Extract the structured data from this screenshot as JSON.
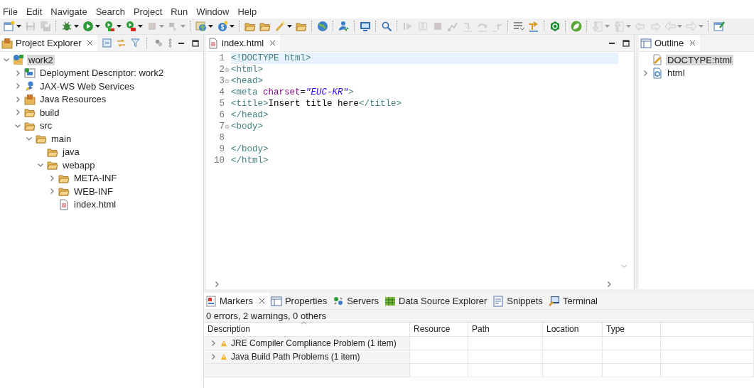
{
  "menu": [
    "File",
    "Edit",
    "Navigate",
    "Search",
    "Project",
    "Run",
    "Window",
    "Help"
  ],
  "toolbar": [
    {
      "kind": "new-window",
      "dropdown": true,
      "disabled": false
    },
    {
      "kind": "save",
      "dropdown": false,
      "disabled": true
    },
    {
      "kind": "save-all",
      "dropdown": false,
      "disabled": true
    },
    {
      "kind": "separator"
    },
    {
      "kind": "bug",
      "dropdown": true,
      "disabled": false
    },
    {
      "kind": "run",
      "dropdown": true,
      "disabled": false
    },
    {
      "kind": "run-coverage",
      "dropdown": true,
      "disabled": false
    },
    {
      "kind": "run-tool",
      "dropdown": true,
      "disabled": false
    },
    {
      "kind": "stop",
      "dropdown": true,
      "disabled": true
    },
    {
      "kind": "step",
      "dropdown": true,
      "disabled": true
    },
    {
      "kind": "separator"
    },
    {
      "kind": "globe-folder",
      "dropdown": true,
      "disabled": false
    },
    {
      "kind": "class",
      "dropdown": true,
      "disabled": false
    },
    {
      "kind": "separator"
    },
    {
      "kind": "folder",
      "dropdown": false,
      "disabled": false
    },
    {
      "kind": "folder",
      "dropdown": false,
      "disabled": false
    },
    {
      "kind": "wand",
      "dropdown": true,
      "disabled": false
    },
    {
      "kind": "folder",
      "dropdown": false,
      "disabled": false
    },
    {
      "kind": "separator"
    },
    {
      "kind": "globe",
      "dropdown": false,
      "disabled": false
    },
    {
      "kind": "separator"
    },
    {
      "kind": "person",
      "dropdown": false,
      "disabled": false
    },
    {
      "kind": "separator"
    },
    {
      "kind": "monitor",
      "dropdown": false,
      "disabled": false
    },
    {
      "kind": "separator"
    },
    {
      "kind": "search",
      "dropdown": false,
      "disabled": false
    },
    {
      "kind": "separator"
    },
    {
      "kind": "resume",
      "dropdown": false,
      "disabled": true
    },
    {
      "kind": "suspend",
      "dropdown": false,
      "disabled": true
    },
    {
      "kind": "stop",
      "dropdown": false,
      "disabled": true
    },
    {
      "kind": "disconnect",
      "dropdown": false,
      "disabled": true
    },
    {
      "kind": "step-into",
      "dropdown": false,
      "disabled": true
    },
    {
      "kind": "step-over",
      "dropdown": false,
      "disabled": true
    },
    {
      "kind": "step-return",
      "dropdown": false,
      "disabled": true
    },
    {
      "kind": "separator"
    },
    {
      "kind": "lines",
      "dropdown": false,
      "disabled": false
    },
    {
      "kind": "drop-frame",
      "dropdown": false,
      "disabled": false
    },
    {
      "kind": "separator"
    },
    {
      "kind": "hexagon",
      "dropdown": false,
      "disabled": false
    },
    {
      "kind": "separator"
    },
    {
      "kind": "leaf",
      "dropdown": false,
      "disabled": false
    },
    {
      "kind": "separator"
    },
    {
      "kind": "down-doc",
      "dropdown": true,
      "disabled": true
    },
    {
      "kind": "up-doc",
      "dropdown": true,
      "disabled": true
    },
    {
      "kind": "back-edit",
      "dropdown": false,
      "disabled": true
    },
    {
      "kind": "fwd-edit",
      "dropdown": false,
      "disabled": true
    },
    {
      "kind": "left",
      "dropdown": true,
      "disabled": true
    },
    {
      "kind": "right",
      "dropdown": true,
      "disabled": true
    },
    {
      "kind": "separator"
    },
    {
      "kind": "edit-window",
      "dropdown": false,
      "disabled": false
    }
  ],
  "explorer": {
    "title": "Project Explorer",
    "tree": [
      {
        "label": "work2",
        "kind": "project",
        "selected": true,
        "expanded": true,
        "children": [
          {
            "label": "Deployment Descriptor: work2",
            "kind": "descriptor",
            "selected": false,
            "expanded": false
          },
          {
            "label": "JAX-WS Web Services",
            "kind": "webservice",
            "selected": false,
            "expanded": false
          },
          {
            "label": "Java Resources",
            "kind": "resources",
            "selected": false,
            "expanded": false
          },
          {
            "label": "build",
            "kind": "folder",
            "selected": false,
            "expanded": false
          },
          {
            "label": "src",
            "kind": "folder",
            "selected": false,
            "expanded": true,
            "children": [
              {
                "label": "main",
                "kind": "folder",
                "selected": false,
                "expanded": true,
                "children": [
                  {
                    "label": "java",
                    "kind": "folder",
                    "selected": false
                  },
                  {
                    "label": "webapp",
                    "kind": "folder",
                    "selected": false,
                    "expanded": true,
                    "children": [
                      {
                        "label": "META-INF",
                        "kind": "folder",
                        "selected": false,
                        "expanded": false
                      },
                      {
                        "label": "WEB-INF",
                        "kind": "folder",
                        "selected": false,
                        "expanded": false
                      },
                      {
                        "label": "index.html",
                        "kind": "file",
                        "selected": false
                      }
                    ]
                  }
                ]
              }
            ]
          }
        ]
      }
    ]
  },
  "editor": {
    "tab": "index.html",
    "lines": [
      {
        "number": "1",
        "fold": false,
        "current": true,
        "tokens": [
          {
            "kind": "tag",
            "text": "<!DOCTYPE html>"
          }
        ]
      },
      {
        "number": "2",
        "fold": true,
        "current": false,
        "tokens": [
          {
            "kind": "tag",
            "text": "<html>"
          }
        ]
      },
      {
        "number": "3",
        "fold": true,
        "current": false,
        "tokens": [
          {
            "kind": "tag",
            "text": "<head>"
          }
        ]
      },
      {
        "number": "4",
        "fold": false,
        "current": false,
        "tokens": [
          {
            "kind": "tag",
            "text": "<meta "
          },
          {
            "kind": "attr",
            "text": "charset"
          },
          {
            "kind": "text",
            "text": "="
          },
          {
            "kind": "string",
            "text": "\"EUC-KR\""
          },
          {
            "kind": "tag",
            "text": ">"
          }
        ]
      },
      {
        "number": "5",
        "fold": false,
        "current": false,
        "tokens": [
          {
            "kind": "tag",
            "text": "<title>"
          },
          {
            "kind": "text",
            "text": "Insert title here"
          },
          {
            "kind": "tag",
            "text": "</title>"
          }
        ]
      },
      {
        "number": "6",
        "fold": false,
        "current": false,
        "tokens": [
          {
            "kind": "tag",
            "text": "</head>"
          }
        ]
      },
      {
        "number": "7",
        "fold": true,
        "current": false,
        "tokens": [
          {
            "kind": "tag",
            "text": "<body>"
          }
        ]
      },
      {
        "number": "8",
        "fold": false,
        "current": false
      },
      {
        "number": "9",
        "fold": false,
        "current": false,
        "tokens": [
          {
            "kind": "tag",
            "text": "</body>"
          }
        ]
      },
      {
        "number": "10",
        "fold": false,
        "current": false,
        "tokens": [
          {
            "kind": "tag",
            "text": "</html>"
          }
        ]
      }
    ]
  },
  "outline": {
    "title": "Outline",
    "items": [
      {
        "label": "DOCTYPE:html",
        "kind": "doctype",
        "selected": true
      },
      {
        "label": "html",
        "kind": "element",
        "selected": false,
        "expanded": false
      }
    ]
  },
  "bottom": {
    "tabs": [
      {
        "label": "Markers",
        "kind": "markers",
        "selected": true
      },
      {
        "label": "Properties",
        "kind": "properties",
        "selected": false
      },
      {
        "label": "Servers",
        "kind": "servers",
        "selected": false
      },
      {
        "label": "Data Source Explorer",
        "kind": "datasource",
        "selected": false
      },
      {
        "label": "Snippets",
        "kind": "snippets",
        "selected": false
      },
      {
        "label": "Terminal",
        "kind": "terminal",
        "selected": false
      }
    ],
    "summary": "0 errors, 2 warnings, 0 others",
    "columns": [
      "Description",
      "Resource",
      "Path",
      "Location",
      "Type"
    ],
    "rows": [
      {
        "description": "JRE Compiler Compliance Problem (1 item)",
        "kind": "warning"
      },
      {
        "description": "Java Build Path Problems (1 item)",
        "kind": "warning"
      }
    ]
  }
}
